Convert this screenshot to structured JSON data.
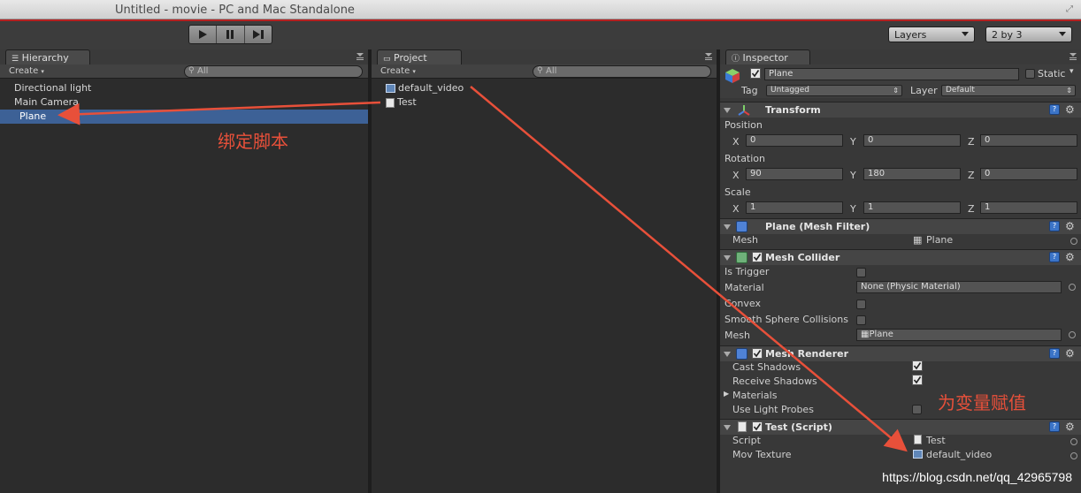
{
  "window": {
    "title": "Untitled - movie - PC and Mac Standalone"
  },
  "toolbar": {
    "layers_label": "Layers",
    "layout_label": "2 by 3"
  },
  "hierarchy": {
    "tab_label": "Hierarchy",
    "create_label": "Create",
    "search_placeholder": "All",
    "items": [
      "Directional light",
      "Main Camera",
      "Plane"
    ],
    "selected_index": 2
  },
  "project": {
    "tab_label": "Project",
    "create_label": "Create",
    "search_placeholder": "All",
    "items": [
      {
        "name": "default_video",
        "icon": "texture-icon"
      },
      {
        "name": "Test",
        "icon": "script-icon"
      }
    ]
  },
  "inspector": {
    "tab_label": "Inspector",
    "object_name": "Plane",
    "active": true,
    "static_label": "Static",
    "tag_label": "Tag",
    "tag_value": "Untagged",
    "layer_label": "Layer",
    "layer_value": "Default",
    "transform": {
      "title": "Transform",
      "position_label": "Position",
      "rotation_label": "Rotation",
      "scale_label": "Scale",
      "position": {
        "x": "0",
        "y": "0",
        "z": "0"
      },
      "rotation": {
        "x": "90",
        "y": "180",
        "z": "0"
      },
      "scale": {
        "x": "1",
        "y": "1",
        "z": "1"
      },
      "axis_x": "X",
      "axis_y": "Y",
      "axis_z": "Z"
    },
    "mesh_filter": {
      "title": "Plane (Mesh Filter)",
      "mesh_label": "Mesh",
      "mesh_value": "Plane"
    },
    "mesh_collider": {
      "title": "Mesh Collider",
      "enabled": true,
      "is_trigger_label": "Is Trigger",
      "is_trigger": false,
      "material_label": "Material",
      "material_value": "None (Physic Material)",
      "convex_label": "Convex",
      "convex": false,
      "smooth_label": "Smooth Sphere Collisions",
      "smooth": false,
      "mesh_label": "Mesh",
      "mesh_value": "Plane"
    },
    "mesh_renderer": {
      "title": "Mesh Renderer",
      "enabled": true,
      "cast_shadows_label": "Cast Shadows",
      "cast_shadows": true,
      "receive_shadows_label": "Receive Shadows",
      "receive_shadows": true,
      "materials_label": "Materials",
      "light_probes_label": "Use Light Probes",
      "light_probes": false
    },
    "test_script": {
      "title": "Test (Script)",
      "enabled": true,
      "script_label": "Script",
      "script_value": "Test",
      "mov_label": "Mov Texture",
      "mov_value": "default_video"
    }
  },
  "annotations": {
    "bind_script": "绑定脚本",
    "assign_variable": "为变量赋值"
  },
  "watermark": "https://blog.csdn.net/qq_42965798",
  "colors": {
    "selection": "#3d6196",
    "annotation": "#e8503a",
    "accent_red": "#b52020"
  }
}
